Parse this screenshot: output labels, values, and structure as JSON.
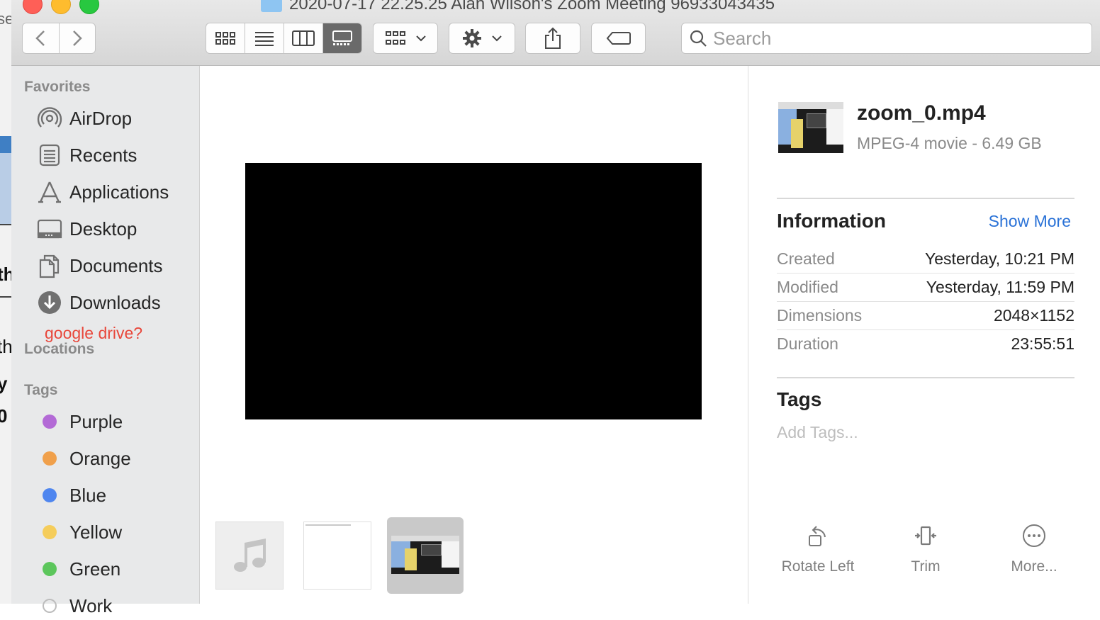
{
  "window": {
    "title": "2020-07-17 22.25.25 Alan Wilson's Zoom Meeting 96933043435"
  },
  "background_fragments": {
    "top": "se",
    "mid1": "th",
    "mid2": "th",
    "mid3": "y",
    "mid4": "0"
  },
  "toolbar": {
    "search_placeholder": "Search"
  },
  "sidebar": {
    "favorites_header": "Favorites",
    "favorites": [
      {
        "label": "AirDrop",
        "icon": "airdrop-icon"
      },
      {
        "label": "Recents",
        "icon": "recents-icon"
      },
      {
        "label": "Applications",
        "icon": "applications-icon"
      },
      {
        "label": "Desktop",
        "icon": "desktop-icon"
      },
      {
        "label": "Documents",
        "icon": "documents-icon"
      },
      {
        "label": "Downloads",
        "icon": "downloads-icon"
      }
    ],
    "annotation": "google drive?",
    "locations_header": "Locations",
    "tags_header": "Tags",
    "tags": [
      {
        "label": "Purple",
        "color": "#b36ad6"
      },
      {
        "label": "Orange",
        "color": "#f0a04b"
      },
      {
        "label": "Blue",
        "color": "#4f86ef"
      },
      {
        "label": "Yellow",
        "color": "#f5cd5b"
      },
      {
        "label": "Green",
        "color": "#5cc65c"
      },
      {
        "label": "Work",
        "color": "#bdbdbd"
      }
    ]
  },
  "inspector": {
    "file_name": "zoom_0.mp4",
    "file_kind": "MPEG-4 movie - 6.49 GB",
    "information_header": "Information",
    "show_more": "Show More",
    "rows": [
      {
        "key": "Created",
        "value": "Yesterday, 10:21 PM"
      },
      {
        "key": "Modified",
        "value": "Yesterday, 11:59 PM"
      },
      {
        "key": "Dimensions",
        "value": "2048×1152"
      },
      {
        "key": "Duration",
        "value": "23:55:51"
      }
    ],
    "tags_header": "Tags",
    "add_tags": "Add Tags...",
    "actions": [
      {
        "label": "Rotate Left",
        "icon": "rotate-left-icon"
      },
      {
        "label": "Trim",
        "icon": "trim-icon"
      },
      {
        "label": "More...",
        "icon": "more-icon"
      }
    ]
  },
  "colors": {
    "accent": "#2a72d7",
    "annotation": "#e8473b"
  }
}
